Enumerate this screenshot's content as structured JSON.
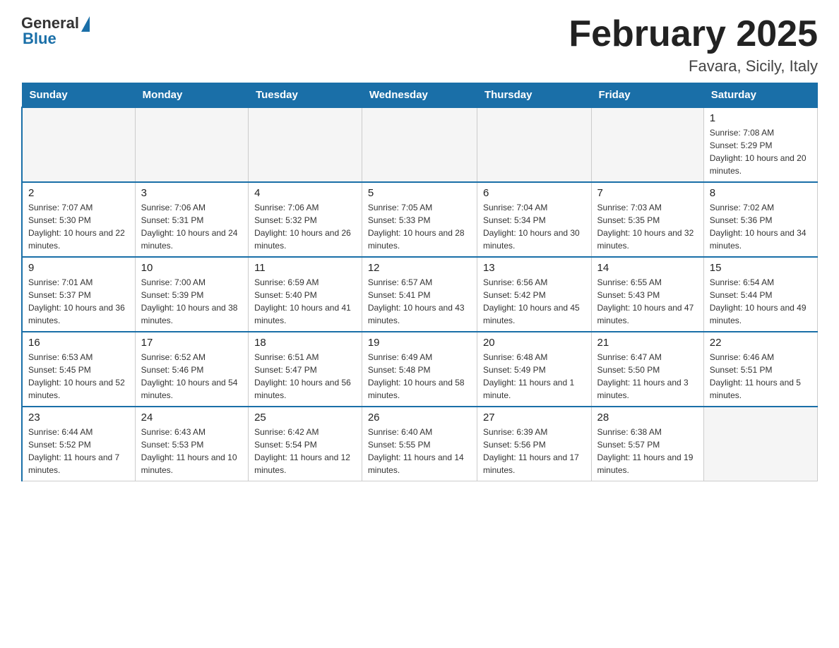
{
  "header": {
    "logo": {
      "general": "General",
      "blue": "Blue"
    },
    "title": "February 2025",
    "location": "Favara, Sicily, Italy"
  },
  "calendar": {
    "weekdays": [
      "Sunday",
      "Monday",
      "Tuesday",
      "Wednesday",
      "Thursday",
      "Friday",
      "Saturday"
    ],
    "weeks": [
      [
        {
          "day": "",
          "info": ""
        },
        {
          "day": "",
          "info": ""
        },
        {
          "day": "",
          "info": ""
        },
        {
          "day": "",
          "info": ""
        },
        {
          "day": "",
          "info": ""
        },
        {
          "day": "",
          "info": ""
        },
        {
          "day": "1",
          "info": "Sunrise: 7:08 AM\nSunset: 5:29 PM\nDaylight: 10 hours and 20 minutes."
        }
      ],
      [
        {
          "day": "2",
          "info": "Sunrise: 7:07 AM\nSunset: 5:30 PM\nDaylight: 10 hours and 22 minutes."
        },
        {
          "day": "3",
          "info": "Sunrise: 7:06 AM\nSunset: 5:31 PM\nDaylight: 10 hours and 24 minutes."
        },
        {
          "day": "4",
          "info": "Sunrise: 7:06 AM\nSunset: 5:32 PM\nDaylight: 10 hours and 26 minutes."
        },
        {
          "day": "5",
          "info": "Sunrise: 7:05 AM\nSunset: 5:33 PM\nDaylight: 10 hours and 28 minutes."
        },
        {
          "day": "6",
          "info": "Sunrise: 7:04 AM\nSunset: 5:34 PM\nDaylight: 10 hours and 30 minutes."
        },
        {
          "day": "7",
          "info": "Sunrise: 7:03 AM\nSunset: 5:35 PM\nDaylight: 10 hours and 32 minutes."
        },
        {
          "day": "8",
          "info": "Sunrise: 7:02 AM\nSunset: 5:36 PM\nDaylight: 10 hours and 34 minutes."
        }
      ],
      [
        {
          "day": "9",
          "info": "Sunrise: 7:01 AM\nSunset: 5:37 PM\nDaylight: 10 hours and 36 minutes."
        },
        {
          "day": "10",
          "info": "Sunrise: 7:00 AM\nSunset: 5:39 PM\nDaylight: 10 hours and 38 minutes."
        },
        {
          "day": "11",
          "info": "Sunrise: 6:59 AM\nSunset: 5:40 PM\nDaylight: 10 hours and 41 minutes."
        },
        {
          "day": "12",
          "info": "Sunrise: 6:57 AM\nSunset: 5:41 PM\nDaylight: 10 hours and 43 minutes."
        },
        {
          "day": "13",
          "info": "Sunrise: 6:56 AM\nSunset: 5:42 PM\nDaylight: 10 hours and 45 minutes."
        },
        {
          "day": "14",
          "info": "Sunrise: 6:55 AM\nSunset: 5:43 PM\nDaylight: 10 hours and 47 minutes."
        },
        {
          "day": "15",
          "info": "Sunrise: 6:54 AM\nSunset: 5:44 PM\nDaylight: 10 hours and 49 minutes."
        }
      ],
      [
        {
          "day": "16",
          "info": "Sunrise: 6:53 AM\nSunset: 5:45 PM\nDaylight: 10 hours and 52 minutes."
        },
        {
          "day": "17",
          "info": "Sunrise: 6:52 AM\nSunset: 5:46 PM\nDaylight: 10 hours and 54 minutes."
        },
        {
          "day": "18",
          "info": "Sunrise: 6:51 AM\nSunset: 5:47 PM\nDaylight: 10 hours and 56 minutes."
        },
        {
          "day": "19",
          "info": "Sunrise: 6:49 AM\nSunset: 5:48 PM\nDaylight: 10 hours and 58 minutes."
        },
        {
          "day": "20",
          "info": "Sunrise: 6:48 AM\nSunset: 5:49 PM\nDaylight: 11 hours and 1 minute."
        },
        {
          "day": "21",
          "info": "Sunrise: 6:47 AM\nSunset: 5:50 PM\nDaylight: 11 hours and 3 minutes."
        },
        {
          "day": "22",
          "info": "Sunrise: 6:46 AM\nSunset: 5:51 PM\nDaylight: 11 hours and 5 minutes."
        }
      ],
      [
        {
          "day": "23",
          "info": "Sunrise: 6:44 AM\nSunset: 5:52 PM\nDaylight: 11 hours and 7 minutes."
        },
        {
          "day": "24",
          "info": "Sunrise: 6:43 AM\nSunset: 5:53 PM\nDaylight: 11 hours and 10 minutes."
        },
        {
          "day": "25",
          "info": "Sunrise: 6:42 AM\nSunset: 5:54 PM\nDaylight: 11 hours and 12 minutes."
        },
        {
          "day": "26",
          "info": "Sunrise: 6:40 AM\nSunset: 5:55 PM\nDaylight: 11 hours and 14 minutes."
        },
        {
          "day": "27",
          "info": "Sunrise: 6:39 AM\nSunset: 5:56 PM\nDaylight: 11 hours and 17 minutes."
        },
        {
          "day": "28",
          "info": "Sunrise: 6:38 AM\nSunset: 5:57 PM\nDaylight: 11 hours and 19 minutes."
        },
        {
          "day": "",
          "info": ""
        }
      ]
    ]
  }
}
